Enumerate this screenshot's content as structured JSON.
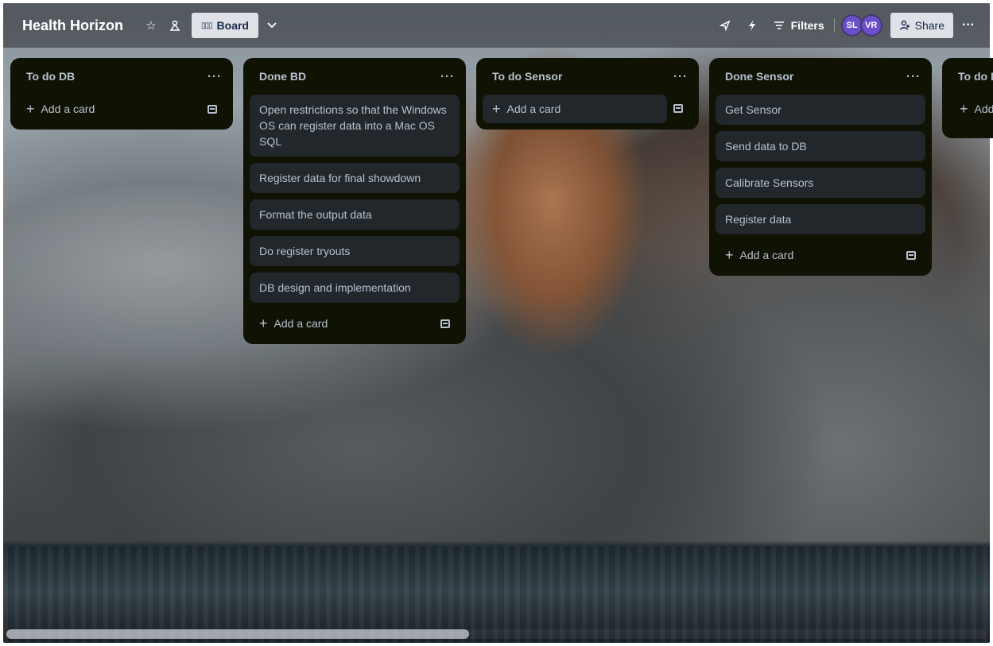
{
  "header": {
    "board_title": "Health Horizon",
    "view_label": "Board",
    "filters_label": "Filters",
    "share_label": "Share",
    "avatars": [
      "SL",
      "VR"
    ],
    "icons": {
      "star": "star-icon",
      "workspace": "workspace-visibility-icon",
      "board_view": "board-view-icon",
      "chevron": "chevron-down-icon",
      "power_ups": "rocket-icon",
      "automation": "lightning-icon",
      "filter": "filter-icon",
      "share": "add-person-icon",
      "more": "more-icon"
    }
  },
  "lists": [
    {
      "title": "To do DB",
      "menu": "···",
      "cards": [],
      "add_card_label": "Add a card"
    },
    {
      "title": "Done BD",
      "menu": "···",
      "cards": [
        "Open restrictions so that the Windows OS can register data into a Mac OS SQL",
        "Register data for final showdown",
        "Format the output data",
        "Do register tryouts",
        "DB design and implementation"
      ],
      "add_card_label": "Add a card"
    },
    {
      "title": "To do Sensor",
      "menu": "···",
      "cards": [],
      "add_card_label": "Add a card"
    },
    {
      "title": "Done Sensor",
      "menu": "···",
      "cards": [
        "Get Sensor",
        "Send data to DB",
        "Calibrate Sensors",
        "Register data"
      ],
      "add_card_label": "Add a card"
    },
    {
      "title": "To do I",
      "menu": "",
      "cards": [],
      "add_card_label": "Add"
    }
  ],
  "colors": {
    "list_bg": "#101204",
    "card_bg": "#22272b",
    "text": "#b6c2cf",
    "avatar": "#6b4ec9"
  }
}
